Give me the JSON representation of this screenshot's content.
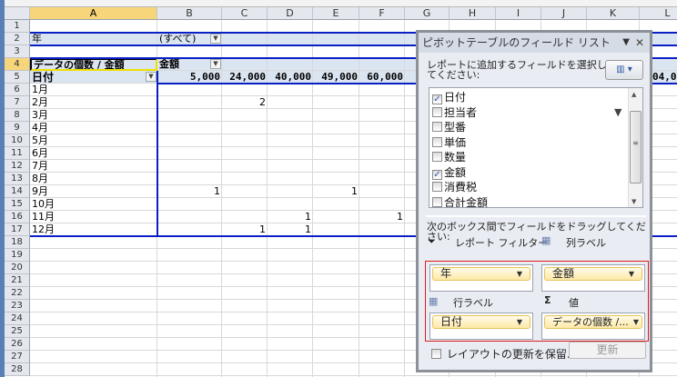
{
  "columns": [
    "A",
    "B",
    "C",
    "D",
    "E",
    "F",
    "G",
    "H",
    "I",
    "J",
    "K",
    "L"
  ],
  "row_numbers": [
    "1",
    "2",
    "3",
    "4",
    "5",
    "6",
    "7",
    "8",
    "9",
    "10",
    "11",
    "12",
    "13",
    "14",
    "15",
    "16",
    "17",
    "18",
    "19",
    "20",
    "21",
    "22",
    "23",
    "24",
    "25",
    "26",
    "27",
    "28"
  ],
  "pivot": {
    "filter_label": "年",
    "filter_value": "(すべて)",
    "value_label": "データの個数 / 金額",
    "col_field": "金額",
    "row_field": "日付",
    "col_values": [
      "5,000",
      "24,000",
      "40,000",
      "49,000",
      "60,000"
    ],
    "col_partial": "04,0",
    "months": [
      "1月",
      "2月",
      "3月",
      "4月",
      "5月",
      "6月",
      "7月",
      "8月",
      "9月",
      "10月",
      "11月",
      "12月"
    ],
    "counts": [
      [
        "",
        "",
        "",
        "",
        ""
      ],
      [
        "",
        "2",
        "",
        "",
        ""
      ],
      [
        "",
        "",
        "",
        "",
        ""
      ],
      [
        "",
        "",
        "",
        "",
        ""
      ],
      [
        "",
        "",
        "",
        "",
        ""
      ],
      [
        "",
        "",
        "",
        "",
        ""
      ],
      [
        "",
        "",
        "",
        "",
        ""
      ],
      [
        "",
        "",
        "",
        "",
        ""
      ],
      [
        "1",
        "",
        "",
        "1",
        ""
      ],
      [
        "",
        "",
        "",
        "",
        ""
      ],
      [
        "",
        "",
        "1",
        "",
        "1"
      ],
      [
        "",
        "1",
        "1",
        "",
        ""
      ]
    ]
  },
  "panel": {
    "title": "ピボットテーブルのフィールド リスト",
    "instruction1": "レポートに追加するフィールドを選択し",
    "instruction2": "てください:",
    "fields": [
      {
        "label": "日付",
        "checked": true
      },
      {
        "label": "担当者",
        "checked": false
      },
      {
        "label": "型番",
        "checked": false
      },
      {
        "label": "単価",
        "checked": false
      },
      {
        "label": "数量",
        "checked": false
      },
      {
        "label": "金額",
        "checked": true
      },
      {
        "label": "消費税",
        "checked": false
      },
      {
        "label": "合計金額",
        "checked": false
      }
    ],
    "drag_instruction": "次のボックス間でフィールドをドラッグしてください:",
    "report_filter_label": "レポート フィルター",
    "column_labels_label": "列ラベル",
    "row_labels_label": "行ラベル",
    "values_label": "値",
    "filter_chip": "年",
    "column_chip": "金額",
    "row_chip": "日付",
    "values_chip": "データの個数 /...",
    "defer_label": "レイアウトの更新を保留...",
    "update_button": "更新"
  }
}
